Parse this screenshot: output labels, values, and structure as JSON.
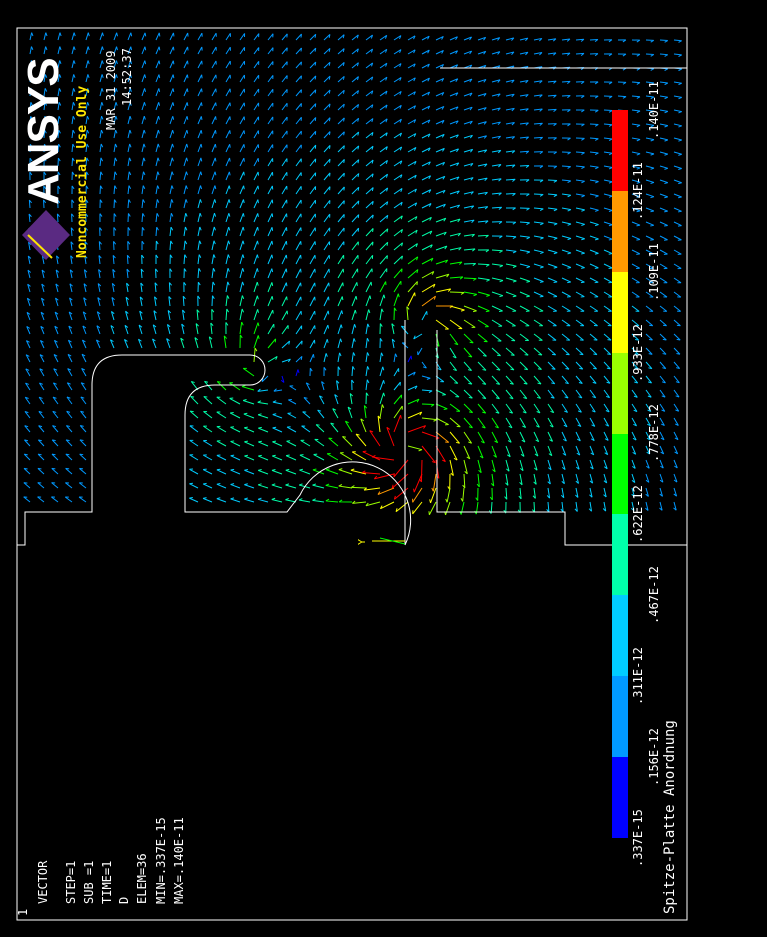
{
  "window_number": "1",
  "info": {
    "lines": [
      "VECTOR",
      "STEP=1",
      "SUB =1",
      "TIME=1",
      "D",
      "ELEM=36",
      "MIN=.337E-15",
      "MAX=.140E-11"
    ]
  },
  "logo": {
    "text": "ANSYS",
    "subtitle": "Noncommercial Use Only"
  },
  "date": "MAR 31 2009",
  "time": "14:52:37",
  "title": "Spitze-Platte Anordnung",
  "axis_label": "Y",
  "legend": {
    "labels": [
      ".337E-15",
      ".156E-12",
      ".311E-12",
      ".467E-12",
      ".622E-12",
      ".778E-12",
      ".933E-12",
      ".109E-11",
      ".124E-11",
      ".140E-11"
    ],
    "colors": [
      "#0000ff",
      "#0099ff",
      "#00ccff",
      "#00ffaa",
      "#00ff00",
      "#99ff00",
      "#ffff00",
      "#ff9900",
      "#ff0000"
    ]
  },
  "colors": {
    "logo_purple": "#5a2a82",
    "logo_yellow": "#ffe600",
    "outline": "#ffffff"
  }
}
